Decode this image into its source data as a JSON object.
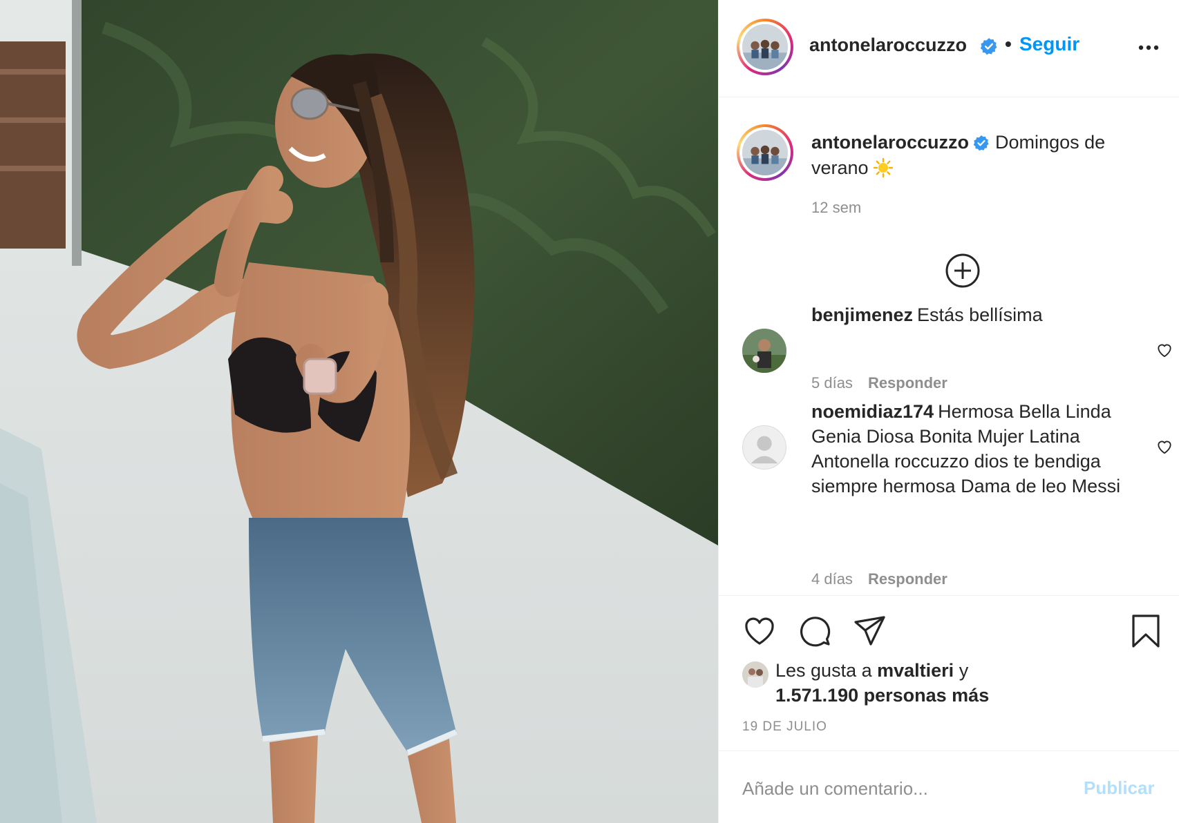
{
  "post": {
    "username": "antonelaroccuzzo",
    "follow_label": "Seguir",
    "separator": "•"
  },
  "caption": {
    "username": "antonelaroccuzzo",
    "text": "Domingos de verano",
    "time": "12 sem"
  },
  "comments": [
    {
      "username": "benjimenez",
      "text": "Estás bellísima",
      "time": "5 días",
      "reply_label": "Responder"
    },
    {
      "username": "noemidiaz174",
      "text": "Hermosa Bella Linda Genia Diosa Bonita Mujer Latina Antonella roccuzzo dios te bendiga siempre hermosa Dama de leo Messi",
      "time": "4 días",
      "reply_label": "Responder"
    }
  ],
  "likes": {
    "prefix": "Les gusta a",
    "user": "mvaltieri",
    "connector": "y",
    "others": "1.571.190 personas más"
  },
  "date": "19 DE JULIO",
  "add_comment": {
    "placeholder": "Añade un comentario...",
    "publish_label": "Publicar"
  },
  "icons": {
    "verified": "verified-badge-icon",
    "more": "more-options-icon",
    "load_more": "load-more-comments-icon",
    "comment_like": "heart-outline-icon",
    "like": "heart-icon",
    "comment": "comment-icon",
    "share": "share-icon",
    "save": "bookmark-icon",
    "sun": "sun-emoji-icon"
  },
  "colors": {
    "link_blue": "#0095f6",
    "publish_disabled": "#b2dffc",
    "muted_text": "#8e8e8e",
    "verified_blue": "#3897f0"
  }
}
